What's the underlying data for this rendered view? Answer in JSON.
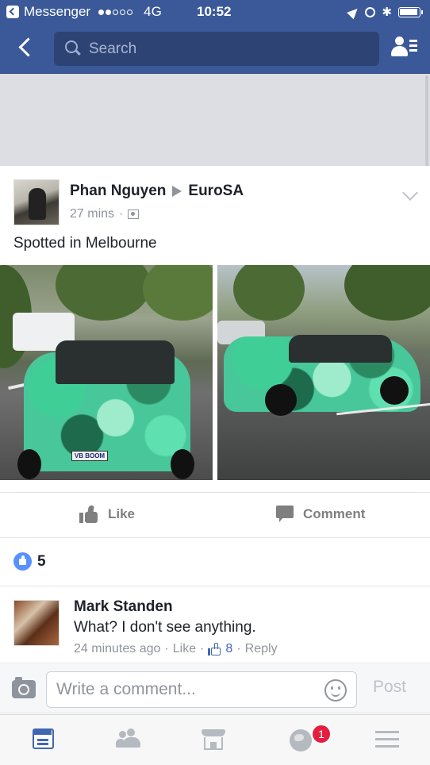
{
  "status_bar": {
    "back_app": "Messenger",
    "network": "4G",
    "time": "10:52"
  },
  "nav": {
    "search_placeholder": "Search"
  },
  "post": {
    "author": "Phan Nguyen",
    "target": "EuroSA",
    "time": "27 mins",
    "text": "Spotted in Melbourne",
    "photo_plate": "VB BOOM"
  },
  "actions": {
    "like_label": "Like",
    "comment_label": "Comment"
  },
  "reactions": {
    "like_count": "5"
  },
  "comment": {
    "author": "Mark Standen",
    "text": "What? I don't see anything.",
    "time": "24 minutes ago",
    "like_link": "Like",
    "like_count": "8",
    "reply_link": "Reply"
  },
  "compose": {
    "placeholder": "Write a comment...",
    "post_label": "Post"
  },
  "tabbar": {
    "notifications_badge": "1"
  },
  "colors": {
    "brand": "#3b5998",
    "accent_blue": "#4267b2",
    "badge_red": "#e41e3f"
  },
  "icons": [
    "back-icon",
    "search-icon",
    "friend-requests-icon",
    "chevron-down-icon",
    "audience-icon",
    "like-icon",
    "comment-icon",
    "camera-icon",
    "emoji-icon",
    "news-feed-icon",
    "friends-icon",
    "marketplace-icon",
    "notifications-icon",
    "menu-icon"
  ]
}
